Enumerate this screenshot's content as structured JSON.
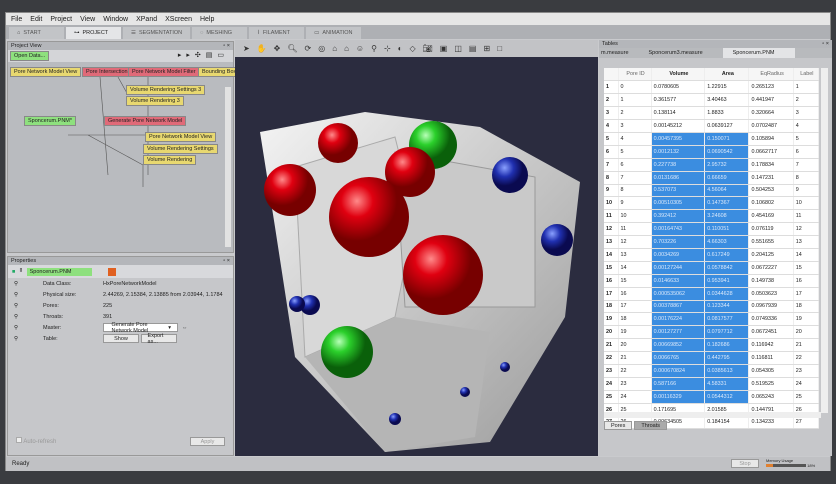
{
  "menu": [
    "File",
    "Edit",
    "Project",
    "View",
    "Window",
    "XPand",
    "XScreen",
    "Help"
  ],
  "tabs": [
    "START",
    "PROJECT",
    "SEGMENTATION",
    "MESHING",
    "FILAMENT",
    "ANIMATION"
  ],
  "project_view": {
    "title": "Project View",
    "open_data": "Open Data...",
    "top_nodes": [
      "Pore Network Model View",
      "Pore Intersection",
      "Pore Network Model Filter",
      "Bounding Box"
    ],
    "nodes": [
      "Volume Rendering Settings 3",
      "Volume Rendering 3",
      "Sponcerum.PNM*",
      "Generate Pore Network Model",
      "Pore Network Model View",
      "Volume Rendering Settings",
      "Volume Rendering"
    ]
  },
  "properties": {
    "title": "Properties",
    "object": "Sponcerum.PNM",
    "rows": [
      {
        "label": "Data Class:",
        "value": "HxPoreNetworkModel"
      },
      {
        "label": "Physical size:",
        "value": "2.44269, 2.15384, 2.13885  from 2.03944, 1.1784"
      },
      {
        "label": "Pores:",
        "value": "225"
      },
      {
        "label": "Throats:",
        "value": "391"
      },
      {
        "label": "Master:",
        "value": "Generate Pore Network Model"
      },
      {
        "label": "Table:",
        "value": ""
      }
    ],
    "show": "Show",
    "export": "Export as...",
    "auto_refresh": "Auto-refresh",
    "apply": "Apply"
  },
  "tables": {
    "title": "Tables",
    "tabs": [
      "m.measure",
      "Sponcerum3.measure",
      "Sponcerum.PNM"
    ],
    "columns": [
      "Pore ID",
      "Volume",
      "Area",
      "EqRadius",
      "Label"
    ],
    "rows": [
      [
        "1",
        "0",
        "0.0780605",
        "1.22915",
        "0.265123",
        "1"
      ],
      [
        "2",
        "1",
        "0.361577",
        "3.40463",
        "0.441947",
        "2"
      ],
      [
        "3",
        "2",
        "0.138114",
        "1.8833",
        "0.320664",
        "3"
      ],
      [
        "4",
        "3",
        "0.00145212",
        "0.0639127",
        "0.0702487",
        "4"
      ],
      [
        "5",
        "4",
        "0.00457395",
        "0.150071",
        "0.105894",
        "5"
      ],
      [
        "6",
        "5",
        "0.0012132",
        "0.0690542",
        "0.0662717",
        "6"
      ],
      [
        "7",
        "6",
        "0.227738",
        "2.95732",
        "0.178834",
        "7"
      ],
      [
        "8",
        "7",
        "0.0131686",
        "0.66659",
        "0.147231",
        "8"
      ],
      [
        "9",
        "8",
        "0.537073",
        "4.56064",
        "0.504253",
        "9"
      ],
      [
        "10",
        "9",
        "0.00510305",
        "0.147367",
        "0.106802",
        "10"
      ],
      [
        "11",
        "10",
        "0.392412",
        "3.24608",
        "0.454169",
        "11"
      ],
      [
        "12",
        "11",
        "0.00164743",
        "0.110051",
        "0.076119",
        "12"
      ],
      [
        "13",
        "12",
        "0.703226",
        "4.66303",
        "0.551655",
        "13"
      ],
      [
        "14",
        "13",
        "0.0034269",
        "0.617249",
        "0.204125",
        "14"
      ],
      [
        "15",
        "14",
        "0.00127244",
        "0.0578842",
        "0.0672227",
        "15"
      ],
      [
        "16",
        "15",
        "0.0146633",
        "0.953941",
        "0.149738",
        "16"
      ],
      [
        "17",
        "16",
        "0.000535062",
        "0.0344628",
        "0.0503623",
        "17"
      ],
      [
        "18",
        "17",
        "0.00378867",
        "0.123344",
        "0.0967939",
        "18"
      ],
      [
        "19",
        "18",
        "0.00176224",
        "0.0817577",
        "0.0749336",
        "19"
      ],
      [
        "20",
        "19",
        "0.00127277",
        "0.0797712",
        "0.0672451",
        "20"
      ],
      [
        "21",
        "20",
        "0.00669852",
        "0.182686",
        "0.116942",
        "21"
      ],
      [
        "22",
        "21",
        "0.0066765",
        "0.442795",
        "0.116811",
        "22"
      ],
      [
        "23",
        "22",
        "0.000670824",
        "0.0385613",
        "0.054305",
        "23"
      ],
      [
        "24",
        "23",
        "0.587166",
        "4.58331",
        "0.519525",
        "24"
      ],
      [
        "25",
        "24",
        "0.00116329",
        "0.0544312",
        "0.065243",
        "25"
      ],
      [
        "26",
        "25",
        "0.171695",
        "2.01585",
        "0.144791",
        "26"
      ],
      [
        "27",
        "26",
        "0.00634505",
        "0.184154",
        "0.134233",
        "27"
      ]
    ],
    "bottom_tabs": [
      "Pores",
      "Throats"
    ]
  },
  "status": {
    "text": "Ready",
    "stop": "Stop",
    "memory_label": "Memory Usage",
    "memory_pct": "18%"
  }
}
